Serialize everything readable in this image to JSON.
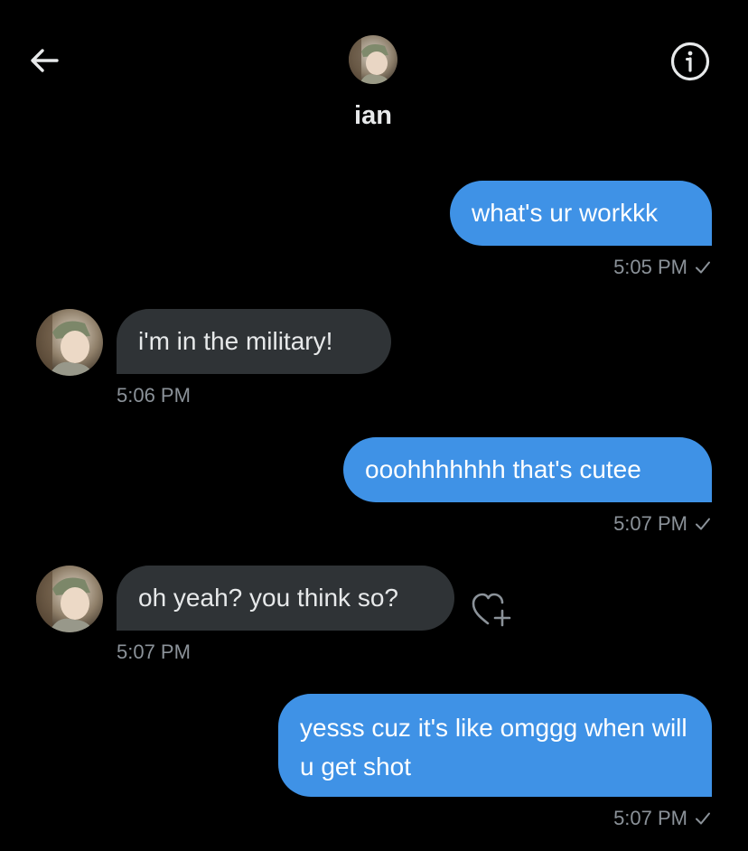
{
  "header": {
    "contact_name": "ian",
    "back_icon": "arrow-left-icon",
    "info_icon": "info-icon"
  },
  "colors": {
    "background": "#000000",
    "sent_bubble": "#3f92e6",
    "received_bubble": "#2f3336",
    "timestamp": "#8b9299"
  },
  "messages": [
    {
      "direction": "sent",
      "text": "what's ur workkk",
      "time": "5:05 PM",
      "status_icon": "check-icon"
    },
    {
      "direction": "received",
      "text": "i'm in the military!",
      "time": "5:06 PM"
    },
    {
      "direction": "sent",
      "text": "ooohhhhhhh that's cutee",
      "time": "5:07 PM",
      "status_icon": "check-icon"
    },
    {
      "direction": "received",
      "text": "oh yeah? you think so?",
      "time": "5:07 PM",
      "reaction_icon": "add-reaction-heart-icon"
    },
    {
      "direction": "sent",
      "text": "yesss cuz it's like omggg when will u get shot",
      "time": "5:07 PM",
      "status_icon": "check-icon"
    }
  ]
}
